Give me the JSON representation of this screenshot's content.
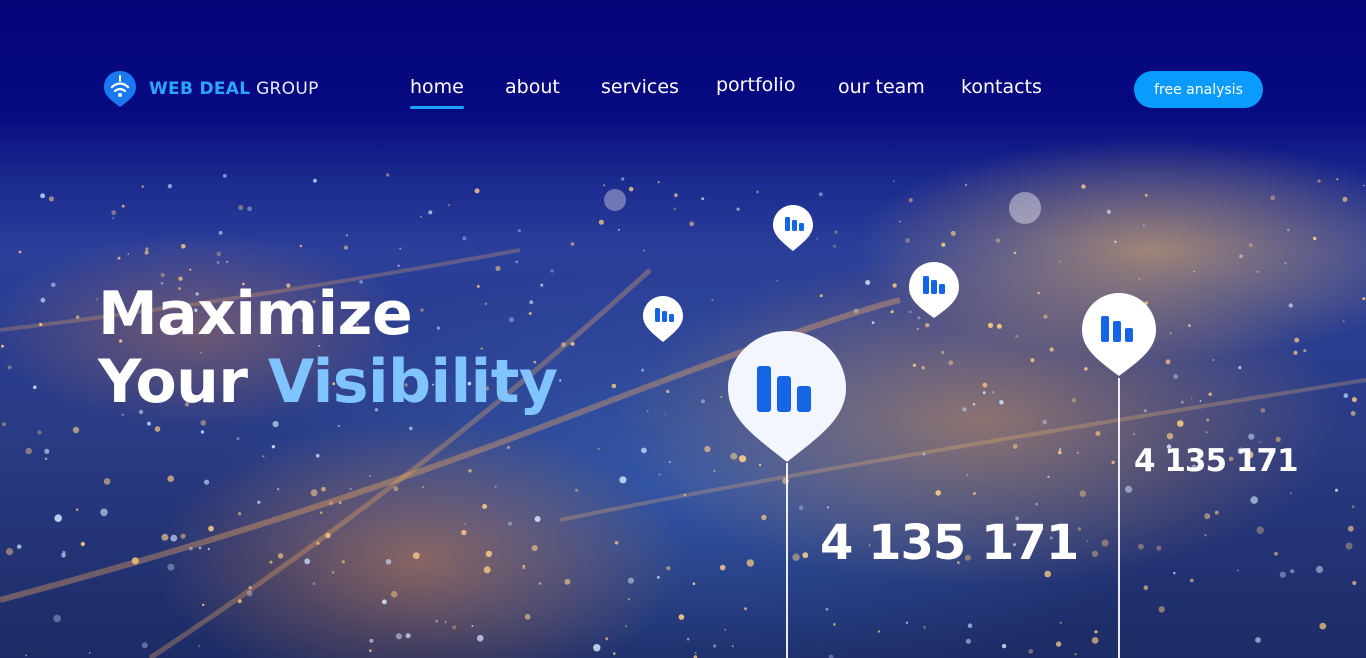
{
  "brand": {
    "name_bold": "WEB DEAL",
    "name_light": "GROUP",
    "icon": "signal-pin-icon"
  },
  "nav": {
    "items": [
      {
        "label": "home",
        "active": true
      },
      {
        "label": "about",
        "active": false
      },
      {
        "label": "services",
        "active": false
      },
      {
        "label": "portfolio",
        "active": false
      },
      {
        "label": "our team",
        "active": false
      },
      {
        "label": "kontacts",
        "active": false
      }
    ]
  },
  "cta": {
    "label": "free analysis"
  },
  "hero": {
    "line1": "Maximize",
    "line2_plain": "Your",
    "line2_highlight": "Visibility"
  },
  "stats": {
    "primary": "4 135 171",
    "secondary": "4 135 171"
  },
  "colors": {
    "accent": "#0a9bff",
    "highlight": "#7fc3ff",
    "header_bg": "#05057a",
    "pin_bar": "#1565e6"
  },
  "icons": {
    "pin": "chart-pin-icon"
  }
}
